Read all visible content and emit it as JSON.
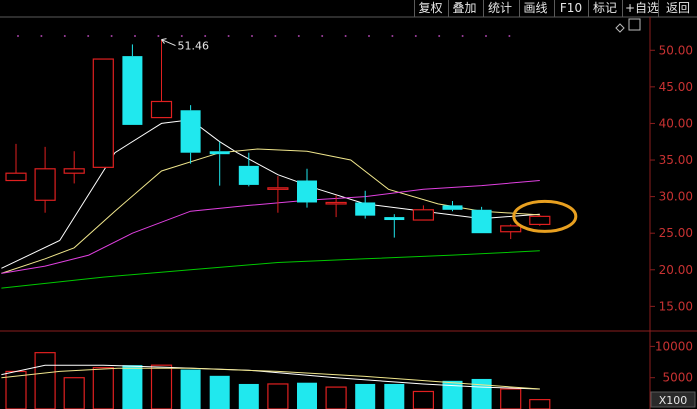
{
  "toolbar": {
    "buttons": [
      {
        "key": "fuquan",
        "label": "复权"
      },
      {
        "key": "diejia",
        "label": "叠加"
      },
      {
        "key": "tongji",
        "label": "统计"
      },
      {
        "key": "huaxian",
        "label": "画线"
      },
      {
        "key": "f10",
        "label": "F10"
      },
      {
        "key": "biaoji",
        "label": "标记"
      },
      {
        "key": "zixuan",
        "label": "+自选"
      },
      {
        "key": "fanhui",
        "label": "返回"
      }
    ]
  },
  "colors": {
    "background": "#000000",
    "up": "#e02020",
    "down": "#20e8ee",
    "axis_text": "#c83232",
    "ma5": "#ffffff",
    "ma10": "#f0e68c",
    "ma20": "#e040e0",
    "ma60": "#00c800",
    "highlight": "#e8a020",
    "grid_dot": "#a040a0"
  },
  "chart_data": {
    "type": "candlestick",
    "price_axis": {
      "ticks": [
        "50.00",
        "45.00",
        "40.00",
        "35.00",
        "30.00",
        "25.00",
        "20.00",
        "15.00"
      ],
      "ylim": [
        13,
        54
      ]
    },
    "volume_axis": {
      "ticks": [
        "10000",
        "5000"
      ],
      "ylim": [
        0,
        11500
      ],
      "multiplier": "X100"
    },
    "high_label": "51.46",
    "candles": [
      {
        "o": 32.2,
        "c": 33.2,
        "h": 37.2,
        "l": 32.2,
        "v": 6000
      },
      {
        "o": 29.5,
        "c": 33.8,
        "h": 36.8,
        "l": 27.8,
        "v": 9000
      },
      {
        "o": 33.2,
        "c": 33.8,
        "h": 36.2,
        "l": 31.8,
        "v": 5000
      },
      {
        "o": 34.0,
        "c": 48.8,
        "h": 48.8,
        "l": 34.0,
        "v": 6600
      },
      {
        "o": 49.2,
        "c": 39.8,
        "h": 50.8,
        "l": 39.8,
        "v": 7000
      },
      {
        "o": 40.8,
        "c": 43.0,
        "h": 51.46,
        "l": 40.8,
        "v": 7000
      },
      {
        "o": 41.8,
        "c": 36.0,
        "h": 42.5,
        "l": 34.5,
        "v": 6300
      },
      {
        "o": 36.2,
        "c": 35.8,
        "h": 37.5,
        "l": 31.5,
        "v": 5300
      },
      {
        "o": 34.2,
        "c": 31.6,
        "h": 36.0,
        "l": 31.4,
        "v": 4000
      },
      {
        "o": 31.0,
        "c": 31.2,
        "h": 32.8,
        "l": 27.8,
        "v": 4000
      },
      {
        "o": 32.2,
        "c": 29.2,
        "h": 33.8,
        "l": 28.5,
        "v": 4200
      },
      {
        "o": 29.0,
        "c": 29.2,
        "h": 30.2,
        "l": 27.2,
        "v": 3500
      },
      {
        "o": 29.2,
        "c": 27.4,
        "h": 30.8,
        "l": 27.0,
        "v": 4000
      },
      {
        "o": 27.2,
        "c": 26.8,
        "h": 27.6,
        "l": 24.4,
        "v": 4000
      },
      {
        "o": 26.8,
        "c": 28.2,
        "h": 28.8,
        "l": 26.8,
        "v": 2800
      },
      {
        "o": 28.8,
        "c": 28.2,
        "h": 29.4,
        "l": 28.0,
        "v": 4500
      },
      {
        "o": 28.2,
        "c": 25.0,
        "h": 28.6,
        "l": 25.0,
        "v": 4800
      },
      {
        "o": 25.2,
        "c": 26.0,
        "h": 26.2,
        "l": 24.2,
        "v": 3200
      },
      {
        "o": 26.2,
        "c": 27.3,
        "h": 27.5,
        "l": 26.0,
        "v": 1500
      }
    ],
    "ma_series": [
      {
        "key": "ma5",
        "points": [
          [
            -0.5,
            20.2
          ],
          [
            1.5,
            24.0
          ],
          [
            3.4,
            36.0
          ],
          [
            5.0,
            40.0
          ],
          [
            6.0,
            40.5
          ],
          [
            7.0,
            37.5
          ],
          [
            7.6,
            36.0
          ],
          [
            9.0,
            33.0
          ],
          [
            10.4,
            31.0
          ],
          [
            12.0,
            29.0
          ],
          [
            14.0,
            28.0
          ],
          [
            16.0,
            27.0
          ],
          [
            18.0,
            27.6
          ]
        ]
      },
      {
        "key": "ma10",
        "points": [
          [
            -0.5,
            19.5
          ],
          [
            1.0,
            21.5
          ],
          [
            2.0,
            23.0
          ],
          [
            3.4,
            28.0
          ],
          [
            5.0,
            33.5
          ],
          [
            7.0,
            36.0
          ],
          [
            8.3,
            36.5
          ],
          [
            10.0,
            36.2
          ],
          [
            11.5,
            35.0
          ],
          [
            12.8,
            31.0
          ],
          [
            14.5,
            29.0
          ],
          [
            16.0,
            28.0
          ],
          [
            18.0,
            27.5
          ]
        ]
      },
      {
        "key": "ma20",
        "points": [
          [
            -0.5,
            19.5
          ],
          [
            1.0,
            20.5
          ],
          [
            2.5,
            22.0
          ],
          [
            4.0,
            25.0
          ],
          [
            6.0,
            28.0
          ],
          [
            8.0,
            28.8
          ],
          [
            10.0,
            29.5
          ],
          [
            12.0,
            30.0
          ],
          [
            14.0,
            31.0
          ],
          [
            16.0,
            31.5
          ],
          [
            18.0,
            32.2
          ]
        ]
      },
      {
        "key": "ma60",
        "points": [
          [
            -0.5,
            17.5
          ],
          [
            3.0,
            19.0
          ],
          [
            6.0,
            20.0
          ],
          [
            9.0,
            21.0
          ],
          [
            12.0,
            21.5
          ],
          [
            15.0,
            22.0
          ],
          [
            18.0,
            22.6
          ]
        ]
      }
    ],
    "vol_ma_series": [
      {
        "key": "ma5",
        "points": [
          [
            -0.5,
            5500
          ],
          [
            1.0,
            7000
          ],
          [
            3.0,
            7000
          ],
          [
            5.0,
            6700
          ],
          [
            8.0,
            6200
          ],
          [
            11.0,
            5000
          ],
          [
            14.0,
            4000
          ],
          [
            16.0,
            3500
          ],
          [
            18.0,
            3200
          ]
        ]
      },
      {
        "key": "ma10",
        "points": [
          [
            -0.5,
            5000
          ],
          [
            1.5,
            6000
          ],
          [
            3.5,
            6500
          ],
          [
            6.0,
            6500
          ],
          [
            9.0,
            6000
          ],
          [
            12.0,
            5200
          ],
          [
            15.0,
            4200
          ],
          [
            18.0,
            3200
          ]
        ]
      }
    ]
  }
}
